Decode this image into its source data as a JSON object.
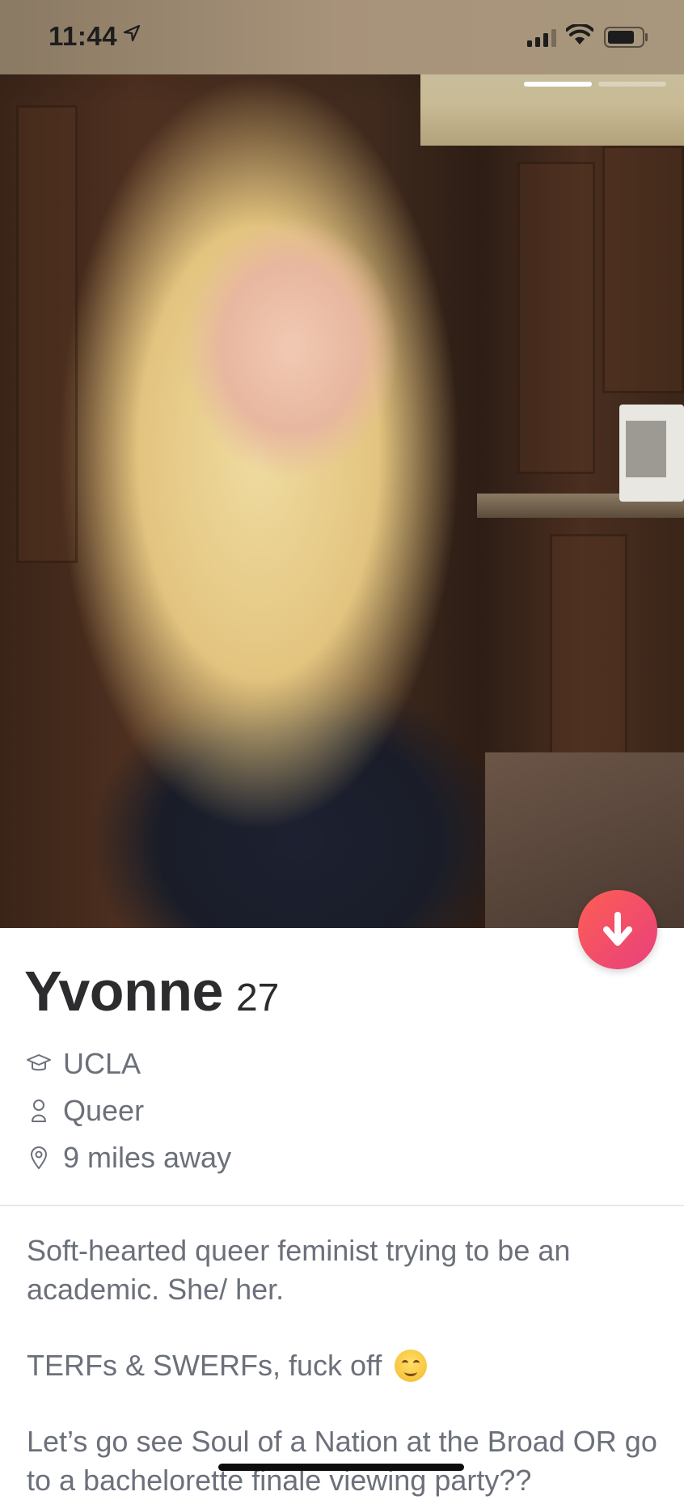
{
  "status_bar": {
    "time": "11:44"
  },
  "photo": {
    "total": 2,
    "active_index": 0,
    "description_icon": "profile-photo"
  },
  "profile": {
    "name": "Yvonne",
    "age": "27",
    "school": "UCLA",
    "orientation": "Queer",
    "distance": "9 miles away"
  },
  "bio": {
    "line1": "Soft-hearted queer feminist trying to be an academic. She/ her.",
    "line2": "TERFs & SWERFs, fuck off",
    "line3": "Let’s go see Soul of a Nation at the Broad OR go to a bachelorette finale viewing party??"
  },
  "colors": {
    "accent_gradient_start": "#fd5e54",
    "accent_gradient_end": "#e8407c"
  }
}
